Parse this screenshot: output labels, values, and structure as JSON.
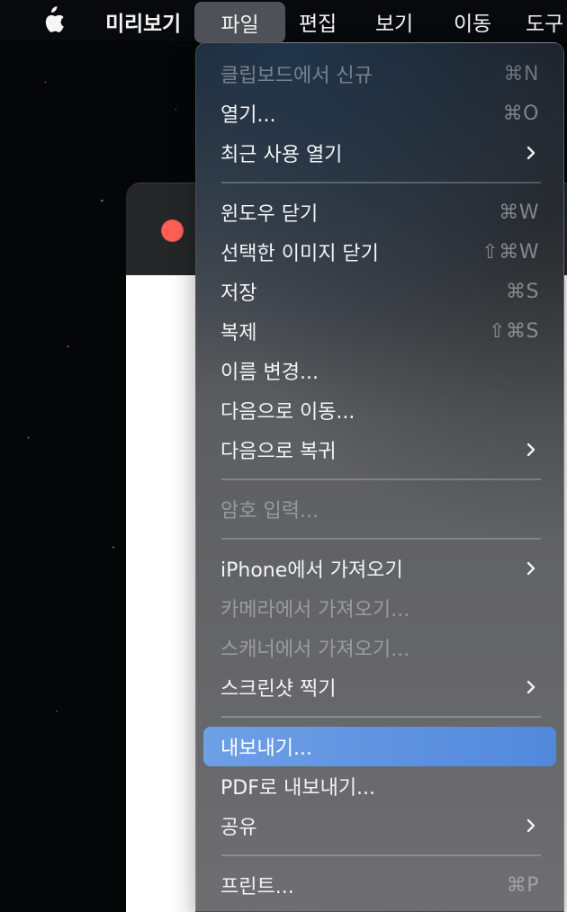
{
  "menubar": {
    "app_name": "미리보기",
    "menus": [
      "파일",
      "편집",
      "보기",
      "이동",
      "도구"
    ],
    "active_menu": "파일"
  },
  "window": {
    "close_button": "close"
  },
  "file_menu": {
    "items": [
      {
        "label": "클립보드에서 신규",
        "shortcut": "⌘N",
        "disabled": true
      },
      {
        "label": "열기...",
        "shortcut": "⌘O"
      },
      {
        "label": "최근 사용 열기",
        "submenu": true
      },
      {
        "label": "윈도우 닫기",
        "shortcut": "⌘W"
      },
      {
        "label": "선택한 이미지 닫기",
        "shortcut": "⇧⌘W"
      },
      {
        "label": "저장",
        "shortcut": "⌘S"
      },
      {
        "label": "복제",
        "shortcut": "⇧⌘S"
      },
      {
        "label": "이름 변경..."
      },
      {
        "label": "다음으로 이동..."
      },
      {
        "label": "다음으로 복귀",
        "submenu": true
      },
      {
        "label": "암호 입력...",
        "disabled": true
      },
      {
        "label": "iPhone에서 가져오기",
        "submenu": true
      },
      {
        "label": "카메라에서 가져오기...",
        "disabled": true
      },
      {
        "label": "스캐너에서 가져오기...",
        "disabled": true
      },
      {
        "label": "스크린샷 찍기",
        "submenu": true
      },
      {
        "label": "내보내기...",
        "selected": true
      },
      {
        "label": "PDF로 내보내기..."
      },
      {
        "label": "공유",
        "submenu": true
      },
      {
        "label": "프린트...",
        "shortcut": "⌘P"
      }
    ]
  },
  "icons": {
    "apple": "apple-logo-icon",
    "submenu": "chevron-right-icon"
  },
  "colors": {
    "selection": "#5a8fdc",
    "close_button": "#ff5f57"
  }
}
